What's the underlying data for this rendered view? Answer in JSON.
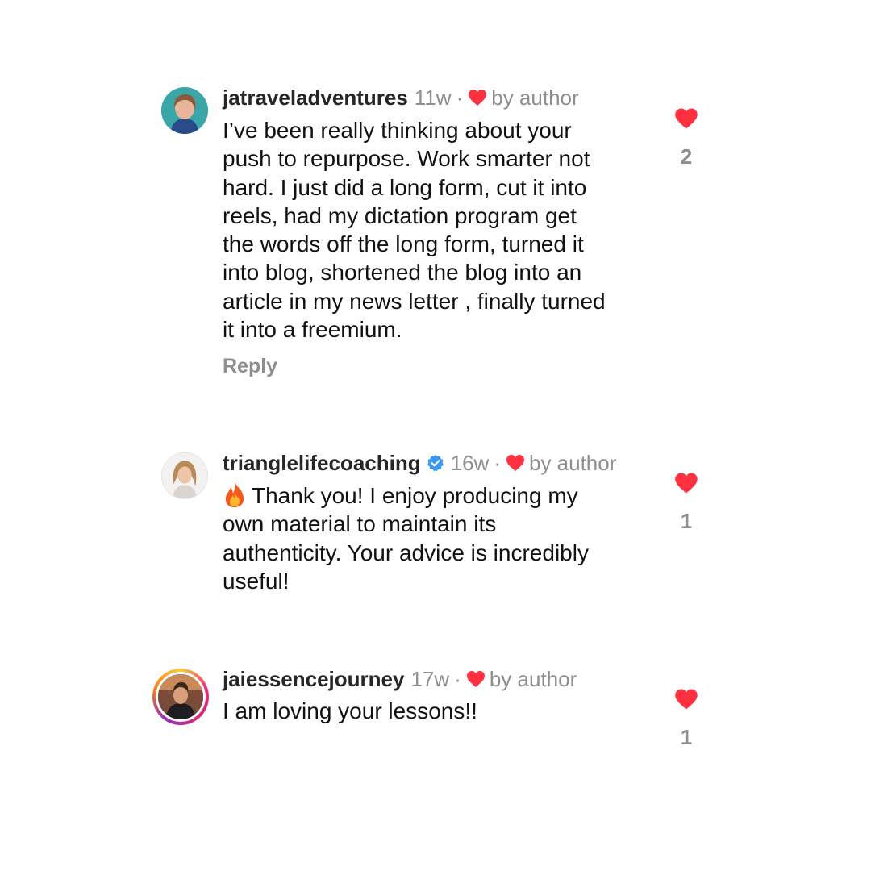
{
  "comments": [
    {
      "username": "jatraveladventures",
      "time": "11w",
      "separator": "·",
      "author_like_label": "by author",
      "text_lines": [
        "I’ve been really thinking about your",
        "push to repurpose. Work smarter not",
        "hard. I just did a long form, cut it into",
        "reels, had my dictation program get",
        "the words off the long form, turned it",
        "into blog, shortened the blog into an",
        "article in my news letter , finally turned",
        "it into a freemium."
      ],
      "reply_label": "Reply",
      "like_count": "2"
    },
    {
      "username": "trianglelifecoaching",
      "verified": true,
      "time": "16w",
      "separator": "·",
      "author_like_label": "by author",
      "emoji": "fire-emoji",
      "text_lines": [
        "Thank you! I enjoy producing my",
        "own material to maintain its",
        "authenticity. Your advice is incredibly",
        "useful!"
      ],
      "like_count": "1"
    },
    {
      "username": "jaiessencejourney",
      "time": "17w",
      "separator": "·",
      "author_like_label": "by author",
      "story_ring": true,
      "text_lines": [
        "I am loving your lessons!!"
      ],
      "like_count": "1"
    }
  ],
  "colors": {
    "like_red": "#ff3040",
    "secondary_text": "#8e8e8e",
    "verified_blue": "#3897f0"
  },
  "icons": {
    "like": "heart-icon",
    "verified": "verified-badge-icon"
  }
}
